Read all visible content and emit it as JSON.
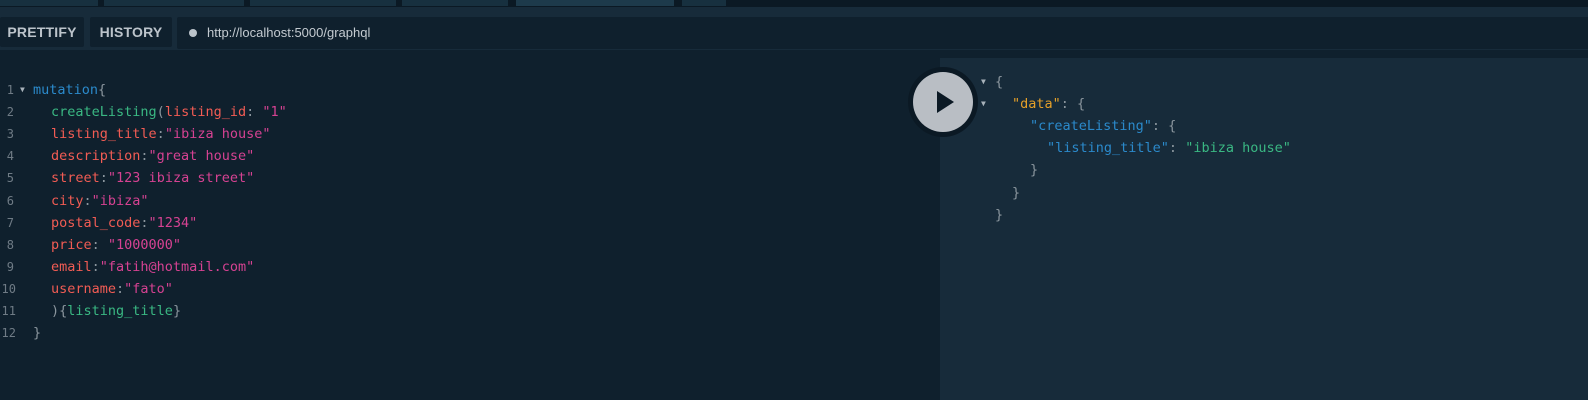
{
  "toolbar": {
    "prettify_label": "PRETTIFY",
    "history_label": "HISTORY",
    "url": "http://localhost:5000/graphql"
  },
  "editor": {
    "line_numbers": [
      "1",
      "2",
      "3",
      "4",
      "5",
      "6",
      "7",
      "8",
      "9",
      "10",
      "11",
      "12"
    ],
    "lines": [
      {
        "parts": [
          [
            "kw",
            "mutation"
          ],
          [
            "punc",
            "{"
          ]
        ]
      },
      {
        "parts": [
          [
            "fn",
            "createListing"
          ],
          [
            "punc",
            "("
          ],
          [
            "arg",
            "listing_id"
          ],
          [
            "punc",
            ": "
          ],
          [
            "str",
            "\"1\""
          ]
        ]
      },
      {
        "parts": [
          [
            "arg",
            "listing_title"
          ],
          [
            "punc",
            ":"
          ],
          [
            "str",
            "\"ibiza house\""
          ]
        ]
      },
      {
        "parts": [
          [
            "arg",
            "description"
          ],
          [
            "punc",
            ":"
          ],
          [
            "str",
            "\"great house\""
          ]
        ]
      },
      {
        "parts": [
          [
            "arg",
            "street"
          ],
          [
            "punc",
            ":"
          ],
          [
            "str",
            "\"123 ibiza street\""
          ]
        ]
      },
      {
        "parts": [
          [
            "arg",
            "city"
          ],
          [
            "punc",
            ":"
          ],
          [
            "str",
            "\"ibiza\""
          ]
        ]
      },
      {
        "parts": [
          [
            "arg",
            "postal_code"
          ],
          [
            "punc",
            ":"
          ],
          [
            "str",
            "\"1234\""
          ]
        ]
      },
      {
        "parts": [
          [
            "arg",
            "price"
          ],
          [
            "punc",
            ": "
          ],
          [
            "str",
            "\"1000000\""
          ]
        ]
      },
      {
        "parts": [
          [
            "arg",
            "email"
          ],
          [
            "punc",
            ":"
          ],
          [
            "str",
            "\"fatih@hotmail.com\""
          ]
        ]
      },
      {
        "parts": [
          [
            "arg",
            "username"
          ],
          [
            "punc",
            ":"
          ],
          [
            "str",
            "\"fato\""
          ]
        ]
      },
      {
        "parts": [
          [
            "punc",
            "){"
          ],
          [
            "fn",
            "listing_title"
          ],
          [
            "punc",
            "}"
          ]
        ]
      },
      {
        "parts": [
          [
            "punc",
            "}"
          ]
        ]
      }
    ]
  },
  "result": {
    "lines": [
      {
        "parts": [
          [
            "punc",
            "{"
          ]
        ]
      },
      {
        "parts": [
          [
            "jdata",
            "\"data\""
          ],
          [
            "punc",
            ": {"
          ]
        ]
      },
      {
        "parts": [
          [
            "jkey",
            "\"createListing\""
          ],
          [
            "punc",
            ": {"
          ]
        ]
      },
      {
        "parts": [
          [
            "jkey",
            "\"listing_title\""
          ],
          [
            "punc",
            ": "
          ],
          [
            "jstr",
            "\"ibiza house\""
          ]
        ]
      },
      {
        "parts": [
          [
            "punc",
            "}"
          ]
        ]
      },
      {
        "parts": [
          [
            "punc",
            "}"
          ]
        ]
      },
      {
        "parts": [
          [
            "punc",
            "}"
          ]
        ]
      }
    ]
  },
  "icons": {
    "play": "play-icon",
    "fold": "fold-arrow-icon",
    "status_dot": "status-dot-icon"
  },
  "colors": {
    "background": "#0f202d",
    "toolbar": "#172b3a",
    "keyword": "#2b8acb",
    "field": "#3ab883",
    "argument": "#f25c54",
    "string": "#d64292",
    "json_data_key": "#e5a029"
  }
}
